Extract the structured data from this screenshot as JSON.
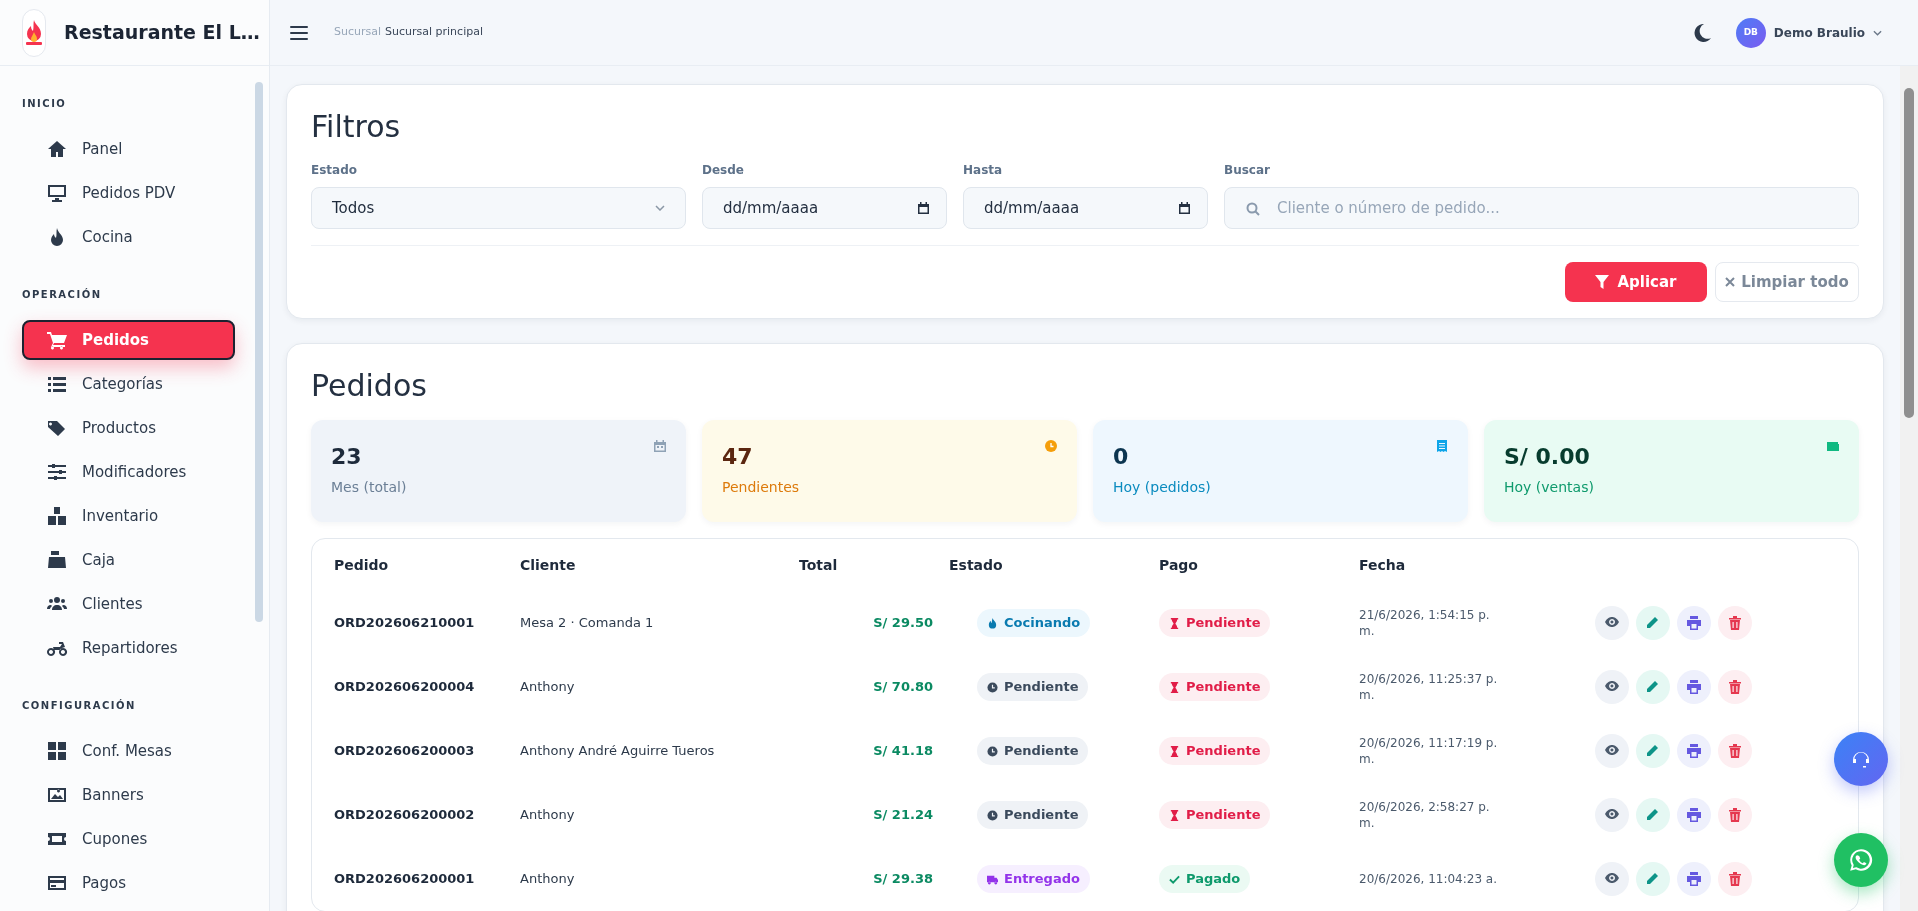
{
  "brand": {
    "title": "Restaurante El L…"
  },
  "sidebar": {
    "sections": [
      {
        "heading": "INICIO",
        "items": [
          {
            "label": "Panel",
            "selected": false
          },
          {
            "label": "Pedidos PDV",
            "selected": false
          },
          {
            "label": "Cocina",
            "selected": false
          }
        ]
      },
      {
        "heading": "OPERACIÓN",
        "items": [
          {
            "label": "Pedidos",
            "selected": true
          },
          {
            "label": "Categorías",
            "selected": false
          },
          {
            "label": "Productos",
            "selected": false
          },
          {
            "label": "Modificadores",
            "selected": false
          },
          {
            "label": "Inventario",
            "selected": false
          },
          {
            "label": "Caja",
            "selected": false
          },
          {
            "label": "Clientes",
            "selected": false
          },
          {
            "label": "Repartidores",
            "selected": false
          }
        ]
      },
      {
        "heading": "CONFIGURACIÓN",
        "items": [
          {
            "label": "Conf. Mesas",
            "selected": false
          },
          {
            "label": "Banners",
            "selected": false
          },
          {
            "label": "Cupones",
            "selected": false
          },
          {
            "label": "Pagos",
            "selected": false
          }
        ]
      }
    ]
  },
  "topbar": {
    "branch_label": "Sucursal",
    "branch_name": "Sucursal principal",
    "user_initials": "DB",
    "user_name": "Demo Braulio"
  },
  "filters": {
    "title": "Filtros",
    "estado": {
      "label": "Estado",
      "value": "Todos"
    },
    "desde": {
      "label": "Desde",
      "placeholder": "dd/mm/aaaa"
    },
    "hasta": {
      "label": "Hasta",
      "placeholder": "dd/mm/aaaa"
    },
    "buscar": {
      "label": "Buscar",
      "placeholder": "Cliente o número de pedido..."
    },
    "buttons": [
      "Aplicar",
      "Limpiar todo"
    ]
  },
  "orders": {
    "title": "Pedidos",
    "stats": [
      {
        "kind": "month",
        "value": "23",
        "label": "Mes (total)"
      },
      {
        "kind": "pending",
        "value": "47",
        "label": "Pendientes"
      },
      {
        "kind": "today_orders",
        "value": "0",
        "label": "Hoy (pedidos)"
      },
      {
        "kind": "today_sales",
        "value": "S/ 0.00",
        "label": "Hoy (ventas)"
      }
    ],
    "table": {
      "columns": [
        "Pedido",
        "Cliente",
        "Total",
        "Estado",
        "Pago",
        "Fecha"
      ],
      "rows": [
        {
          "pedido": "ORD202606210001",
          "cliente": "Mesa 2 · Comanda 1",
          "total": "S/ 29.50",
          "estado": {
            "kind": "cooking",
            "text": "Cocinando"
          },
          "pago": {
            "kind": "pending",
            "text": "Pendiente"
          },
          "fecha": "21/6/2026, 1:54:15 p. m."
        },
        {
          "pedido": "ORD202606200004",
          "cliente": "Anthony",
          "total": "S/ 70.80",
          "estado": {
            "kind": "pending",
            "text": "Pendiente"
          },
          "pago": {
            "kind": "pending",
            "text": "Pendiente"
          },
          "fecha": "20/6/2026, 11:25:37 p. m."
        },
        {
          "pedido": "ORD202606200003",
          "cliente": "Anthony André Aguirre Tueros",
          "total": "S/ 41.18",
          "estado": {
            "kind": "pending",
            "text": "Pendiente"
          },
          "pago": {
            "kind": "pending",
            "text": "Pendiente"
          },
          "fecha": "20/6/2026, 11:17:19 p. m."
        },
        {
          "pedido": "ORD202606200002",
          "cliente": "Anthony",
          "total": "S/ 21.24",
          "estado": {
            "kind": "pending",
            "text": "Pendiente"
          },
          "pago": {
            "kind": "pending",
            "text": "Pendiente"
          },
          "fecha": "20/6/2026, 2:58:27 p. m."
        },
        {
          "pedido": "ORD202606200001",
          "cliente": "Anthony",
          "total": "S/ 29.38",
          "estado": {
            "kind": "delivered",
            "text": "Entregado"
          },
          "pago": {
            "kind": "paid",
            "text": "Pagado"
          },
          "fecha": "20/6/2026, 11:04:23 a."
        }
      ]
    }
  }
}
